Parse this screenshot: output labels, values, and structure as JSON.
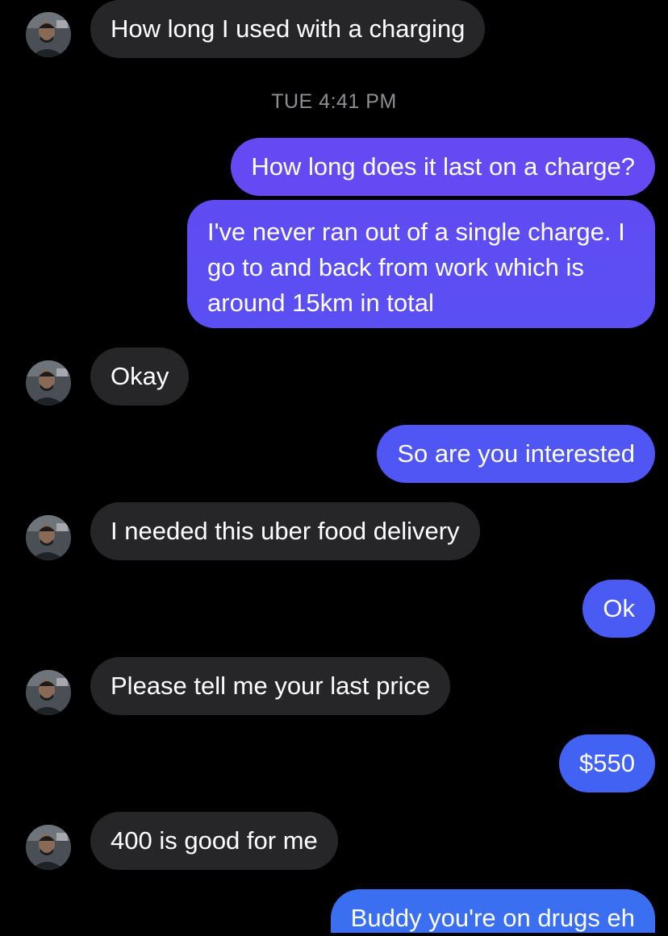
{
  "conversation": {
    "timestamp": "TUE 4:41 PM",
    "messages": [
      {
        "from": "them",
        "text": "How long I used with a charging"
      },
      {
        "from": "me",
        "text": "How long does it last on a charge?"
      },
      {
        "from": "me",
        "text": "I've never ran out of a single charge. I go to and back from work which is around 15km in total"
      },
      {
        "from": "them",
        "text": "Okay"
      },
      {
        "from": "me",
        "text": "So are you interested"
      },
      {
        "from": "them",
        "text": "I needed this uber food delivery"
      },
      {
        "from": "me",
        "text": "Ok"
      },
      {
        "from": "them",
        "text": "Please tell me your last price"
      },
      {
        "from": "me",
        "text": "$550"
      },
      {
        "from": "them",
        "text": "400 is good for me"
      },
      {
        "from": "me",
        "text": "Buddy you're on drugs eh"
      }
    ]
  },
  "colors": {
    "background": "#000000",
    "incoming_bubble": "#262628",
    "outgoing_gradient_top": "#6a48f2",
    "outgoing_gradient_bottom": "#3a6ff2",
    "timestamp_text": "#8e8e93"
  },
  "icons": {
    "sender_avatar": "avatar"
  }
}
